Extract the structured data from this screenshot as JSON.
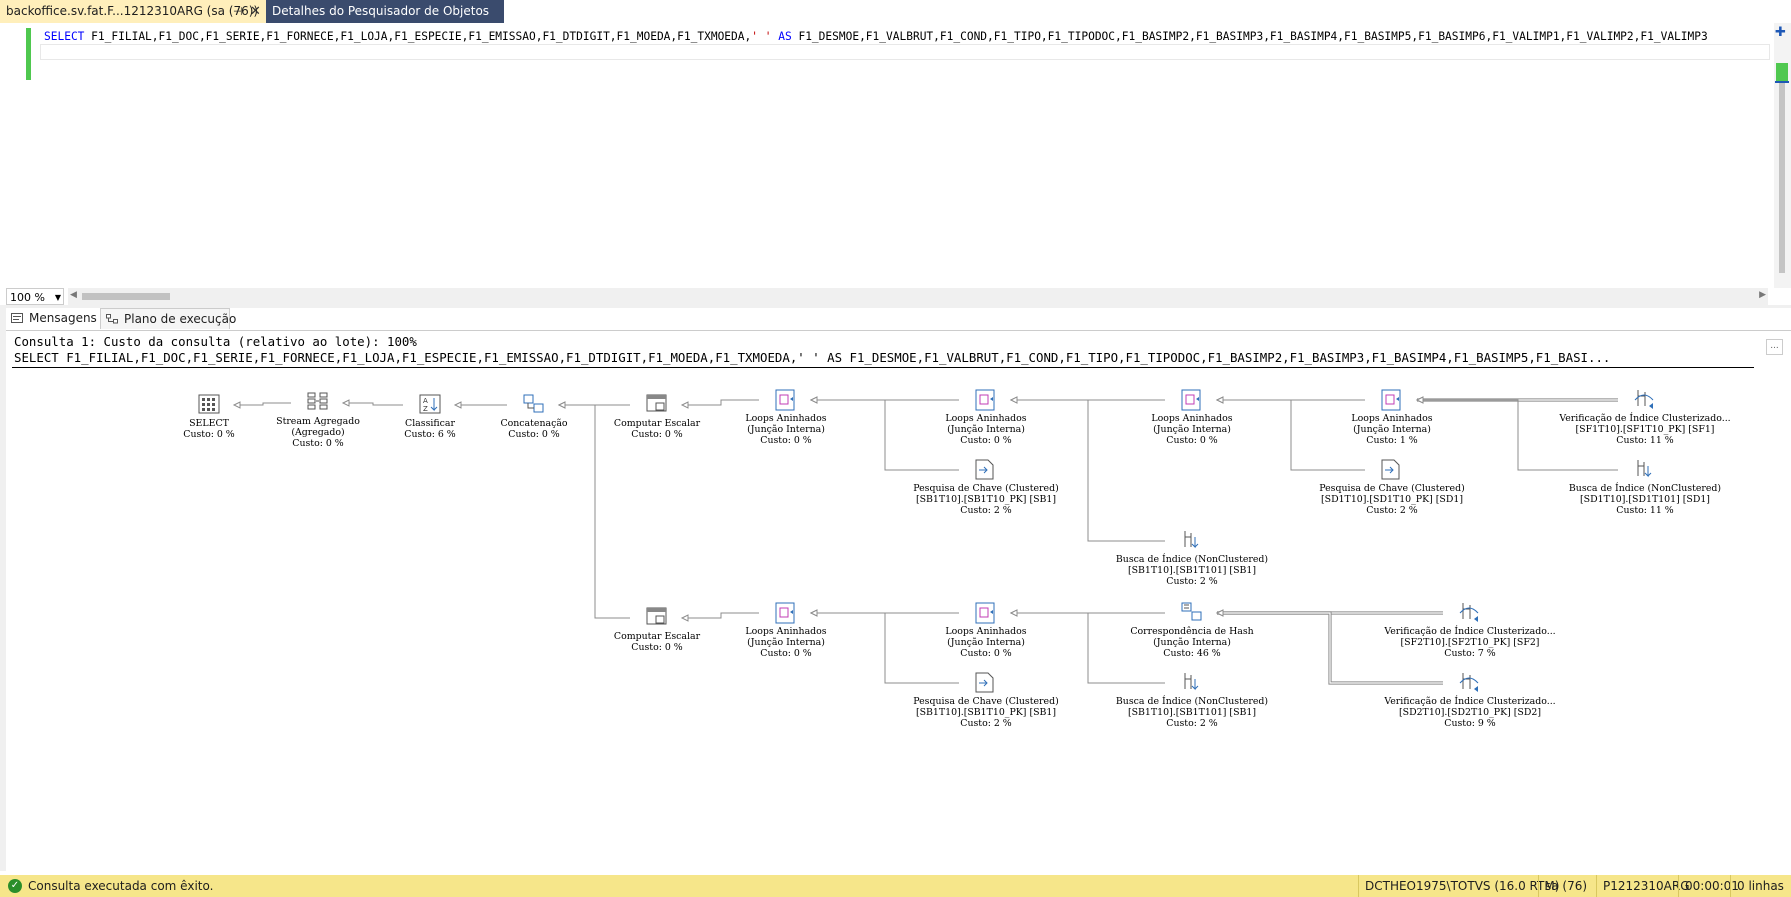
{
  "tabs": {
    "active_title": "backoffice.sv.fat.F...1212310ARG (sa (76))",
    "second_title": "Detalhes do Pesquisador de Objetos"
  },
  "editor": {
    "sql_keyword": "SELECT",
    "sql_part1": "F1_FILIAL,F1_DOC,F1_SERIE,F1_FORNECE,F1_LOJA,F1_ESPECIE,F1_EMISSAO,F1_DTDIGIT,F1_MOEDA,F1_TXMOEDA,",
    "sql_string": "' '",
    "sql_as": "AS",
    "sql_part2": "F1_DESMOE,F1_VALBRUT,F1_COND,F1_TIPO,F1_TIPODOC,F1_BASIMP2,F1_BASIMP3,F1_BASIMP4,F1_BASIMP5,F1_BASIMP6,F1_VALIMP1,F1_VALIMP2,F1_VALIMP3",
    "zoom": "100 %"
  },
  "result_tabs": {
    "messages": "Mensagens",
    "plan": "Plano de execução"
  },
  "plan": {
    "header_line1": "Consulta 1: Custo da consulta (relativo ao lote): 100%",
    "header_line2": "SELECT F1_FILIAL,F1_DOC,F1_SERIE,F1_FORNECE,F1_LOJA,F1_ESPECIE,F1_EMISSAO,F1_DTDIGIT,F1_MOEDA,F1_TXMOEDA,' ' AS F1_DESMOE,F1_VALBRUT,F1_COND,F1_TIPO,F1_TIPODOC,F1_BASIMP2,F1_BASIMP3,F1_BASIMP4,F1_BASIMP5,F1_BASI...",
    "more_label": "...",
    "nodes": [
      {
        "id": "select",
        "icon": "select",
        "lines": [
          "SELECT",
          "Custo: 0 %"
        ]
      },
      {
        "id": "stream",
        "icon": "stream",
        "lines": [
          "Stream Agregado",
          "(Agregado)",
          "Custo: 0 %"
        ]
      },
      {
        "id": "sort",
        "icon": "sort",
        "lines": [
          "Classificar",
          "Custo: 6 %"
        ]
      },
      {
        "id": "concat",
        "icon": "concat",
        "lines": [
          "Concatenação",
          "Custo: 0 %"
        ]
      },
      {
        "id": "cs1",
        "icon": "compute",
        "lines": [
          "Computar Escalar",
          "Custo: 0 %"
        ]
      },
      {
        "id": "nl1",
        "icon": "loop",
        "lines": [
          "Loops Aninhados",
          "(Junção Interna)",
          "Custo: 0 %"
        ]
      },
      {
        "id": "nl2",
        "icon": "loop",
        "lines": [
          "Loops Aninhados",
          "(Junção Interna)",
          "Custo: 0 %"
        ]
      },
      {
        "id": "nl3",
        "icon": "loop",
        "lines": [
          "Loops Aninhados",
          "(Junção Interna)",
          "Custo: 0 %"
        ]
      },
      {
        "id": "nl4",
        "icon": "loop",
        "lines": [
          "Loops Aninhados",
          "(Junção Interna)",
          "Custo: 1 %"
        ]
      },
      {
        "id": "scan1",
        "icon": "scan",
        "lines": [
          "Verificação de Índice Clusterizado...",
          "[SF1T10].[SF1T10_PK] [SF1]",
          "Custo: 11 %"
        ]
      },
      {
        "id": "key1",
        "icon": "key",
        "lines": [
          "Pesquisa de Chave (Clustered)",
          "[SB1T10].[SB1T10_PK] [SB1]",
          "Custo: 2 %"
        ]
      },
      {
        "id": "key2",
        "icon": "key",
        "lines": [
          "Pesquisa de Chave (Clustered)",
          "[SD1T10].[SD1T10_PK] [SD1]",
          "Custo: 2 %"
        ]
      },
      {
        "id": "seek1",
        "icon": "seek",
        "lines": [
          "Busca de Índice (NonClustered)",
          "[SD1T10].[SD1T101] [SD1]",
          "Custo: 11 %"
        ]
      },
      {
        "id": "seek2",
        "icon": "seek",
        "lines": [
          "Busca de Índice (NonClustered)",
          "[SB1T10].[SB1T101] [SB1]",
          "Custo: 2 %"
        ]
      },
      {
        "id": "cs2",
        "icon": "compute",
        "lines": [
          "Computar Escalar",
          "Custo: 0 %"
        ]
      },
      {
        "id": "nl5",
        "icon": "loop",
        "lines": [
          "Loops Aninhados",
          "(Junção Interna)",
          "Custo: 0 %"
        ]
      },
      {
        "id": "nl6",
        "icon": "loop",
        "lines": [
          "Loops Aninhados",
          "(Junção Interna)",
          "Custo: 0 %"
        ]
      },
      {
        "id": "hash",
        "icon": "hash",
        "lines": [
          "Correspondência de Hash",
          "(Junção Interna)",
          "Custo: 46 %"
        ]
      },
      {
        "id": "scan2",
        "icon": "scan",
        "lines": [
          "Verificação de Índice Clusterizado...",
          "[SF2T10].[SF2T10_PK] [SF2]",
          "Custo: 7 %"
        ]
      },
      {
        "id": "key3",
        "icon": "key",
        "lines": [
          "Pesquisa de Chave (Clustered)",
          "[SB1T10].[SB1T10_PK] [SB1]",
          "Custo: 2 %"
        ]
      },
      {
        "id": "seek3",
        "icon": "seek",
        "lines": [
          "Busca de Índice (NonClustered)",
          "[SB1T10].[SB1T101] [SB1]",
          "Custo: 2 %"
        ]
      },
      {
        "id": "scan3",
        "icon": "scan",
        "lines": [
          "Verificação de Índice Clusterizado...",
          "[SD2T10].[SD2T10_PK] [SD2]",
          "Custo: 9 %"
        ]
      }
    ]
  },
  "status": {
    "message": "Consulta executada com êxito.",
    "server": "DCTHEO1975\\TOTVS (16.0 RTM)",
    "user": "sa (76)",
    "database": "P1212310ARG",
    "elapsed": "00:00:01",
    "rows": "0 linhas"
  }
}
